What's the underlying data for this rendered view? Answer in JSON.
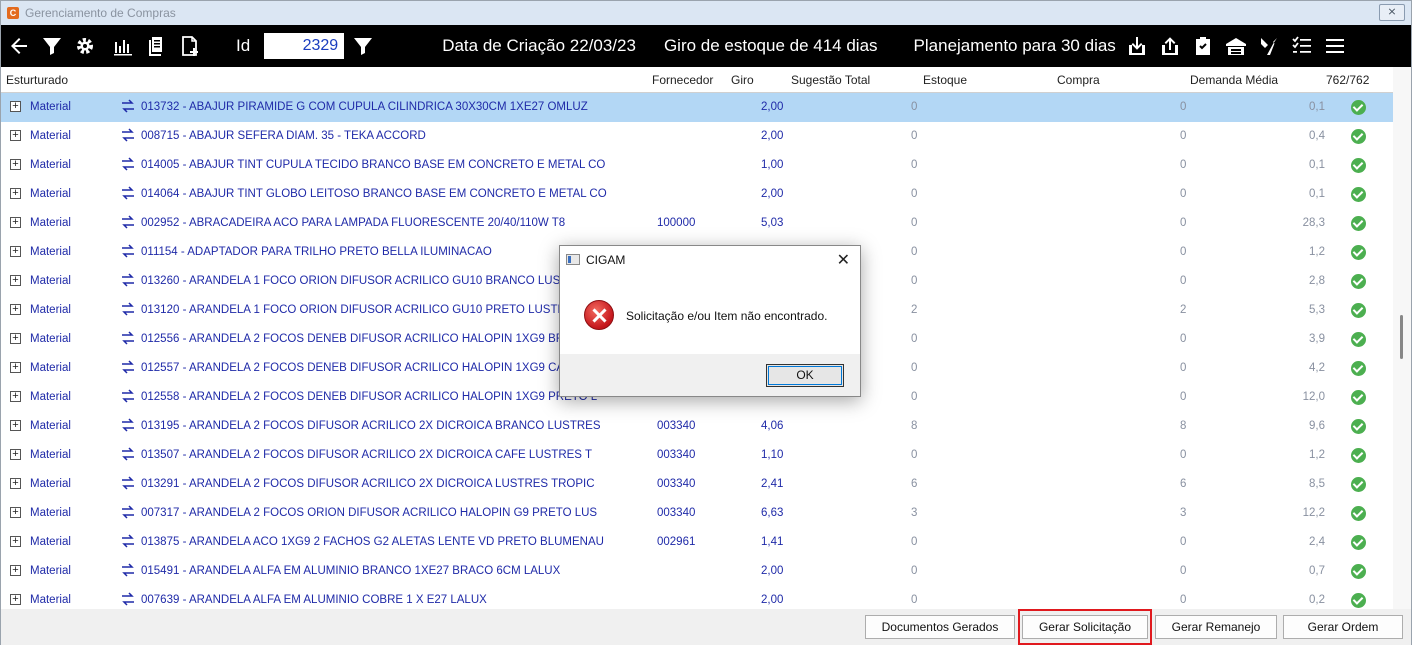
{
  "window": {
    "title": "Gerenciamento de Compras",
    "close_label": "⨯"
  },
  "toolbar": {
    "id_label": "Id",
    "id_value": "2329",
    "creation_date": "Data de Criação 22/03/23",
    "stock_turn": "Giro de estoque de  414 dias",
    "planning": "Planejamento para 30 dias"
  },
  "grid": {
    "columns": {
      "structured": "Esturturado",
      "supplier": "Fornecedor",
      "turn": "Giro",
      "total_suggestion": "Sugestão Total",
      "stock": "Estoque",
      "purchase": "Compra",
      "avg_demand": "Demanda Média",
      "count": "762/762"
    },
    "rows": [
      {
        "type": "Material",
        "item": "013732 - ABAJUR PIRAMIDE G COM CUPULA CILINDRICA 30X30CM 1XE27 OMLUZ",
        "supplier": "",
        "turn": "2,00",
        "stock": "0",
        "purchase": "0",
        "demand": "0,1"
      },
      {
        "type": "Material",
        "item": "008715 - ABAJUR SEFERA DIAM. 35 - TEKA ACCORD",
        "supplier": "",
        "turn": "2,00",
        "stock": "0",
        "purchase": "0",
        "demand": "0,4"
      },
      {
        "type": "Material",
        "item": "014005 - ABAJUR TINT CUPULA TECIDO BRANCO BASE EM CONCRETO E METAL CO",
        "supplier": "",
        "turn": "1,00",
        "stock": "0",
        "purchase": "0",
        "demand": "0,1"
      },
      {
        "type": "Material",
        "item": "014064 - ABAJUR TINT GLOBO LEITOSO BRANCO BASE EM CONCRETO E METAL CO",
        "supplier": "",
        "turn": "2,00",
        "stock": "0",
        "purchase": "0",
        "demand": "0,1"
      },
      {
        "type": "Material",
        "item": "002952 - ABRACADEIRA ACO PARA LAMPADA FLUORESCENTE 20/40/110W T8",
        "supplier": "100000",
        "turn": "5,03",
        "stock": "0",
        "purchase": "0",
        "demand": "28,3"
      },
      {
        "type": "Material",
        "item": "011154 - ADAPTADOR PARA TRILHO PRETO BELLA ILUMINACAO",
        "supplier": "",
        "turn": "",
        "stock": "0",
        "purchase": "0",
        "demand": "1,2"
      },
      {
        "type": "Material",
        "item": "013260 - ARANDELA 1 FOCO ORION DIFUSOR ACRILICO GU10  BRANCO LUSTRES",
        "supplier": "",
        "turn": "",
        "stock": "0",
        "purchase": "0",
        "demand": "2,8"
      },
      {
        "type": "Material",
        "item": "013120 - ARANDELA 1 FOCO ORION DIFUSOR ACRILICO GU10 PRETO LUSTRES TR",
        "supplier": "",
        "turn": "",
        "stock": "2",
        "purchase": "2",
        "demand": "5,3"
      },
      {
        "type": "Material",
        "item": "012556 - ARANDELA 2 FOCOS DENEB DIFUSOR ACRILICO HALOPIN 1XG9 BRANCO",
        "supplier": "",
        "turn": "",
        "stock": "0",
        "purchase": "0",
        "demand": "3,9"
      },
      {
        "type": "Material",
        "item": "012557 - ARANDELA 2 FOCOS DENEB DIFUSOR ACRILICO HALOPIN 1XG9 CAFE LU",
        "supplier": "",
        "turn": "",
        "stock": "0",
        "purchase": "0",
        "demand": "4,2"
      },
      {
        "type": "Material",
        "item": "012558 - ARANDELA 2 FOCOS DENEB DIFUSOR ACRILICO HALOPIN 1XG9 PRETO L",
        "supplier": "",
        "turn": "",
        "stock": "0",
        "purchase": "0",
        "demand": "12,0"
      },
      {
        "type": "Material",
        "item": "013195 - ARANDELA 2 FOCOS DIFUSOR ACRILICO 2X DICROICA BRANCO LUSTRES",
        "supplier": "003340",
        "turn": "4,06",
        "stock": "8",
        "purchase": "8",
        "demand": "9,6"
      },
      {
        "type": "Material",
        "item": "013507 - ARANDELA 2 FOCOS DIFUSOR ACRILICO 2X DICROICA CAFE LUSTRES T",
        "supplier": "003340",
        "turn": "1,10",
        "stock": "0",
        "purchase": "0",
        "demand": "1,2"
      },
      {
        "type": "Material",
        "item": "013291 - ARANDELA 2 FOCOS DIFUSOR ACRILICO 2X DICROICA LUSTRES TROPIC",
        "supplier": "003340",
        "turn": "2,41",
        "stock": "6",
        "purchase": "6",
        "demand": "8,5"
      },
      {
        "type": "Material",
        "item": "007317 - ARANDELA 2 FOCOS ORION DIFUSOR ACRILICO HALOPIN G9 PRETO LUS",
        "supplier": "003340",
        "turn": "6,63",
        "stock": "3",
        "purchase": "3",
        "demand": "12,2"
      },
      {
        "type": "Material",
        "item": "013875 - ARANDELA ACO 1XG9 2 FACHOS G2 ALETAS LENTE VD PRETO BLUMENAU",
        "supplier": "002961",
        "turn": "1,41",
        "stock": "0",
        "purchase": "0",
        "demand": "2,4"
      },
      {
        "type": "Material",
        "item": "015491 - ARANDELA ALFA EM ALUMINIO BRANCO 1XE27 BRACO 6CM LALUX",
        "supplier": "",
        "turn": "2,00",
        "stock": "0",
        "purchase": "0",
        "demand": "0,7"
      },
      {
        "type": "Material",
        "item": "007639 - ARANDELA ALFA EM ALUMINIO COBRE 1 X E27 LALUX",
        "supplier": "",
        "turn": "2,00",
        "stock": "0",
        "purchase": "0",
        "demand": "0,2"
      }
    ]
  },
  "buttons": {
    "generated_docs": "Documentos Gerados",
    "generate_request": "Gerar Solicitação",
    "generate_relocation": "Gerar Remanejo",
    "generate_order": "Gerar Ordem"
  },
  "dialog": {
    "title": "CIGAM",
    "close": "✕",
    "message": "Solicitação e/ou Item não encontrado.",
    "ok": "OK"
  },
  "colors": {
    "selected_row": "#b3d7f5",
    "link_text": "#1f2aa8",
    "check_green": "#4caf50",
    "highlight_red": "#e0191e"
  }
}
